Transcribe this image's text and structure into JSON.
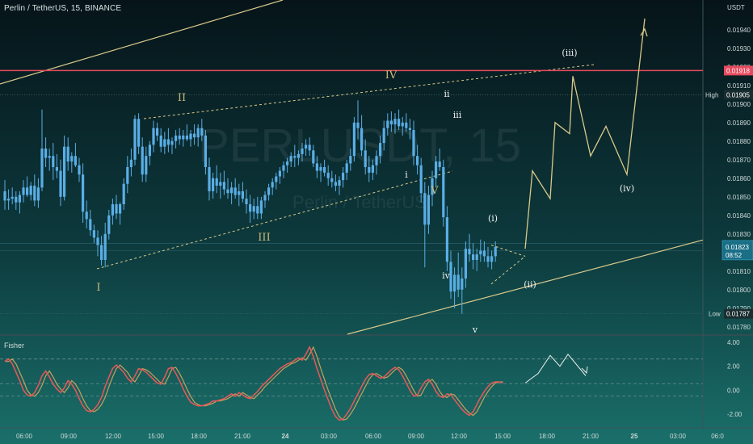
{
  "header": {
    "symbol_line": "Perlin / TetherUS, 15, BINANCE"
  },
  "watermark": {
    "ticker": "PERLUSDT, 15",
    "name": "Perlin / TetherUS"
  },
  "colors": {
    "bg_top": "#061419",
    "bg_bottom": "#1a6f6a",
    "candle": "#5aaee6",
    "wave_line": "#d9c98a",
    "resistance": "#e64a5e",
    "fisher": "#e0585c",
    "axis_text": "#cfdada"
  },
  "price_axis": {
    "currency": "USDT",
    "ticks": [
      "0.01940",
      "0.01930",
      "0.01920",
      "0.01910",
      "0.01900",
      "0.01890",
      "0.01880",
      "0.01870",
      "0.01860",
      "0.01850",
      "0.01840",
      "0.01830",
      "0.01820",
      "0.01810",
      "0.01800",
      "0.01790",
      "0.01780"
    ],
    "resistance_label": "0.01918",
    "high": {
      "label": "High",
      "value": "0.01905"
    },
    "last": {
      "value": "0.01823",
      "countdown": "08:52"
    },
    "low": {
      "label": "Low",
      "value": "0.01787"
    }
  },
  "time_axis": {
    "labels": [
      "06:00",
      "09:00",
      "12:00",
      "15:00",
      "18:00",
      "21:00",
      "24",
      "03:00",
      "06:00",
      "09:00",
      "12:00",
      "15:00",
      "18:00",
      "21:00",
      "25",
      "03:00",
      "06:0"
    ]
  },
  "fisher": {
    "title": "Fisher",
    "ticks": [
      "4.00",
      "2.00",
      "0.00",
      "-2.00"
    ]
  },
  "wave_labels": {
    "major": [
      "I",
      "II",
      "III",
      "IV",
      "V"
    ],
    "minor": [
      "i",
      "ii",
      "iii",
      "iv",
      "v"
    ],
    "projected": [
      "(i)",
      "(ii)",
      "(iii)",
      "(iv)"
    ]
  },
  "chart_data": {
    "type": "candlestick",
    "timeframe": "15",
    "exchange": "BINANCE",
    "y_range": [
      0.01776,
      0.01956
    ],
    "resistance": 0.01918,
    "high": 0.01905,
    "low": 0.01787,
    "last": 0.01823,
    "candles": [
      [
        0.01853,
        0.01859,
        0.01843,
        0.01848
      ],
      [
        0.01848,
        0.01854,
        0.01843,
        0.01849
      ],
      [
        0.01849,
        0.01855,
        0.01846,
        0.0185
      ],
      [
        0.0185,
        0.01853,
        0.01843,
        0.01847
      ],
      [
        0.01847,
        0.01853,
        0.01841,
        0.01851
      ],
      [
        0.01851,
        0.01859,
        0.01847,
        0.01855
      ],
      [
        0.01855,
        0.01861,
        0.0185,
        0.01851
      ],
      [
        0.01851,
        0.01858,
        0.01848,
        0.01856
      ],
      [
        0.01856,
        0.01862,
        0.01845,
        0.01848
      ],
      [
        0.01848,
        0.0186,
        0.01844,
        0.01855
      ],
      [
        0.01855,
        0.01897,
        0.01853,
        0.01876
      ],
      [
        0.01876,
        0.01882,
        0.01866,
        0.01871
      ],
      [
        0.01871,
        0.01876,
        0.01864,
        0.01872
      ],
      [
        0.01872,
        0.01879,
        0.01859,
        0.01866
      ],
      [
        0.01866,
        0.01873,
        0.0186,
        0.01864
      ],
      [
        0.01864,
        0.0187,
        0.01845,
        0.0185
      ],
      [
        0.0185,
        0.01883,
        0.01848,
        0.01877
      ],
      [
        0.01877,
        0.01882,
        0.01864,
        0.01869
      ],
      [
        0.01869,
        0.01874,
        0.01863,
        0.01872
      ],
      [
        0.01872,
        0.01879,
        0.01866,
        0.01867
      ],
      [
        0.01867,
        0.01871,
        0.01858,
        0.01862
      ],
      [
        0.01862,
        0.01868,
        0.01836,
        0.01842
      ],
      [
        0.01842,
        0.01848,
        0.01833,
        0.01838
      ],
      [
        0.01838,
        0.01843,
        0.01829,
        0.01832
      ],
      [
        0.01832,
        0.01835,
        0.01825,
        0.01828
      ],
      [
        0.01828,
        0.01832,
        0.01818,
        0.01824
      ],
      [
        0.01824,
        0.01829,
        0.01813,
        0.01816
      ],
      [
        0.01816,
        0.01836,
        0.01812,
        0.0183
      ],
      [
        0.0183,
        0.01843,
        0.01827,
        0.0184
      ],
      [
        0.0184,
        0.01849,
        0.01835,
        0.01846
      ],
      [
        0.01846,
        0.01851,
        0.01838,
        0.01841
      ],
      [
        0.01841,
        0.01847,
        0.01835,
        0.01846
      ],
      [
        0.01846,
        0.0186,
        0.01843,
        0.01857
      ],
      [
        0.01857,
        0.01872,
        0.01852,
        0.01866
      ],
      [
        0.01866,
        0.01876,
        0.01861,
        0.0187
      ],
      [
        0.0187,
        0.01894,
        0.01867,
        0.01892
      ],
      [
        0.01892,
        0.01895,
        0.01873,
        0.01877
      ],
      [
        0.01877,
        0.01882,
        0.01858,
        0.01862
      ],
      [
        0.01862,
        0.01877,
        0.01858,
        0.01872
      ],
      [
        0.01872,
        0.0188,
        0.01867,
        0.01878
      ],
      [
        0.01878,
        0.01891,
        0.01874,
        0.01887
      ],
      [
        0.01887,
        0.0189,
        0.0188,
        0.01883
      ],
      [
        0.01883,
        0.01887,
        0.01874,
        0.01877
      ],
      [
        0.01877,
        0.01885,
        0.01873,
        0.01881
      ],
      [
        0.01881,
        0.01887,
        0.01874,
        0.01878
      ],
      [
        0.01878,
        0.01882,
        0.01873,
        0.0188
      ],
      [
        0.0188,
        0.01886,
        0.01876,
        0.01883
      ],
      [
        0.01883,
        0.01887,
        0.01878,
        0.01881
      ],
      [
        0.01881,
        0.01886,
        0.01877,
        0.01883
      ],
      [
        0.01883,
        0.01889,
        0.0188,
        0.01881
      ],
      [
        0.01881,
        0.01886,
        0.01877,
        0.01884
      ],
      [
        0.01884,
        0.01889,
        0.01878,
        0.01882
      ],
      [
        0.01882,
        0.01889,
        0.01877,
        0.01887
      ],
      [
        0.01887,
        0.01892,
        0.0188,
        0.01883
      ],
      [
        0.01883,
        0.01886,
        0.01862,
        0.01866
      ],
      [
        0.01866,
        0.01871,
        0.01848,
        0.01853
      ],
      [
        0.01853,
        0.01863,
        0.01849,
        0.0186
      ],
      [
        0.0186,
        0.01867,
        0.01852,
        0.01856
      ],
      [
        0.01856,
        0.01863,
        0.01849,
        0.01858
      ],
      [
        0.01858,
        0.01864,
        0.01851,
        0.01854
      ],
      [
        0.01854,
        0.0186,
        0.01849,
        0.01852
      ],
      [
        0.01852,
        0.01858,
        0.01846,
        0.01855
      ],
      [
        0.01855,
        0.0186,
        0.01849,
        0.01851
      ],
      [
        0.01851,
        0.01857,
        0.01845,
        0.01853
      ],
      [
        0.01853,
        0.01858,
        0.01847,
        0.01849
      ],
      [
        0.01849,
        0.01854,
        0.01841,
        0.01846
      ],
      [
        0.01846,
        0.01851,
        0.01836,
        0.01842
      ],
      [
        0.01842,
        0.01849,
        0.01838,
        0.01845
      ],
      [
        0.01845,
        0.0185,
        0.01838,
        0.01841
      ],
      [
        0.01841,
        0.0185,
        0.01838,
        0.01848
      ],
      [
        0.01848,
        0.01853,
        0.01844,
        0.01851
      ],
      [
        0.01851,
        0.01857,
        0.01848,
        0.01855
      ],
      [
        0.01855,
        0.0186,
        0.01851,
        0.01858
      ],
      [
        0.01858,
        0.01863,
        0.01854,
        0.01861
      ],
      [
        0.01861,
        0.01866,
        0.01857,
        0.01864
      ],
      [
        0.01864,
        0.01869,
        0.0186,
        0.01867
      ],
      [
        0.01867,
        0.01871,
        0.01863,
        0.01869
      ],
      [
        0.01869,
        0.01874,
        0.01866,
        0.01872
      ],
      [
        0.01872,
        0.01878,
        0.01866,
        0.01871
      ],
      [
        0.01871,
        0.01875,
        0.01867,
        0.01873
      ],
      [
        0.01873,
        0.01879,
        0.01869,
        0.01876
      ],
      [
        0.01876,
        0.01881,
        0.01872,
        0.01878
      ],
      [
        0.01878,
        0.01882,
        0.01872,
        0.01875
      ],
      [
        0.01875,
        0.01878,
        0.01866,
        0.01868
      ],
      [
        0.01868,
        0.01872,
        0.0186,
        0.01864
      ],
      [
        0.01864,
        0.01868,
        0.01858,
        0.01866
      ],
      [
        0.01866,
        0.0187,
        0.01861,
        0.01863
      ],
      [
        0.01863,
        0.01867,
        0.01856,
        0.0186
      ],
      [
        0.0186,
        0.01864,
        0.01855,
        0.01858
      ],
      [
        0.01858,
        0.01862,
        0.01853,
        0.01856
      ],
      [
        0.01856,
        0.01861,
        0.01851,
        0.01859
      ],
      [
        0.01859,
        0.01866,
        0.01855,
        0.01863
      ],
      [
        0.01863,
        0.0187,
        0.01859,
        0.01868
      ],
      [
        0.01868,
        0.01876,
        0.01864,
        0.01872
      ],
      [
        0.01872,
        0.01893,
        0.01869,
        0.0189
      ],
      [
        0.0189,
        0.01902,
        0.01881,
        0.01887
      ],
      [
        0.01887,
        0.01894,
        0.01872,
        0.01875
      ],
      [
        0.01875,
        0.01881,
        0.01862,
        0.01866
      ],
      [
        0.01866,
        0.01872,
        0.01858,
        0.01863
      ],
      [
        0.01863,
        0.0187,
        0.01859,
        0.01867
      ],
      [
        0.01867,
        0.01875,
        0.01862,
        0.01872
      ],
      [
        0.01872,
        0.01883,
        0.01868,
        0.01879
      ],
      [
        0.01879,
        0.01891,
        0.01875,
        0.01887
      ],
      [
        0.01887,
        0.01895,
        0.01883,
        0.01891
      ],
      [
        0.01891,
        0.01896,
        0.01885,
        0.01889
      ],
      [
        0.01889,
        0.01895,
        0.01884,
        0.01892
      ],
      [
        0.01892,
        0.01897,
        0.01886,
        0.01888
      ],
      [
        0.01888,
        0.01893,
        0.01883,
        0.0189
      ],
      [
        0.0189,
        0.01895,
        0.01885,
        0.01887
      ],
      [
        0.01887,
        0.01892,
        0.01881,
        0.01886
      ],
      [
        0.01886,
        0.01891,
        0.01867,
        0.01872
      ],
      [
        0.01872,
        0.01878,
        0.01862,
        0.01867
      ],
      [
        0.01867,
        0.01871,
        0.01847,
        0.01852
      ],
      [
        0.01852,
        0.01858,
        0.01812,
        0.01835
      ],
      [
        0.01835,
        0.01856,
        0.0183,
        0.01851
      ],
      [
        0.01851,
        0.01864,
        0.01845,
        0.0186
      ],
      [
        0.0186,
        0.01872,
        0.01855,
        0.01869
      ],
      [
        0.01869,
        0.01876,
        0.01864,
        0.01866
      ],
      [
        0.01866,
        0.0187,
        0.01834,
        0.01839
      ],
      [
        0.01839,
        0.01845,
        0.0181,
        0.01815
      ],
      [
        0.01815,
        0.01821,
        0.01795,
        0.01799
      ],
      [
        0.01799,
        0.01812,
        0.0179,
        0.01808
      ],
      [
        0.01808,
        0.0182,
        0.01796,
        0.018
      ],
      [
        0.018,
        0.01812,
        0.01787,
        0.01806
      ],
      [
        0.01806,
        0.01826,
        0.01801,
        0.01822
      ],
      [
        0.01822,
        0.0183,
        0.01815,
        0.01819
      ],
      [
        0.01819,
        0.01825,
        0.01811,
        0.01816
      ],
      [
        0.01816,
        0.01822,
        0.0181,
        0.01819
      ],
      [
        0.01819,
        0.01827,
        0.01815,
        0.01821
      ],
      [
        0.01821,
        0.01826,
        0.01815,
        0.01818
      ],
      [
        0.01818,
        0.01823,
        0.01812,
        0.01815
      ],
      [
        0.01815,
        0.01821,
        0.01811,
        0.01818
      ],
      [
        0.01818,
        0.01826,
        0.01815,
        0.01823
      ]
    ],
    "candles_format": "[open, high, low, close]",
    "projection_path": [
      0.01822,
      0.01864,
      0.01849,
      0.0189,
      0.01884,
      0.01915,
      0.01872,
      0.01888,
      0.01862,
      0.01946
    ],
    "fisher_indicator": {
      "y_range": [
        -2.6,
        4.4
      ],
      "levels": [
        2.6,
        0.55,
        -0.5
      ],
      "fisher": [
        2.4,
        2.6,
        2.2,
        1.5,
        0.8,
        0.0,
        -0.4,
        -0.5,
        -0.2,
        0.4,
        1.2,
        1.6,
        1.1,
        0.5,
        0.1,
        -0.2,
        0.2,
        0.8,
        0.5,
        0.0,
        -0.7,
        -1.3,
        -1.7,
        -1.8,
        -1.6,
        -1.2,
        -0.6,
        0.3,
        1.1,
        1.8,
        2.1,
        1.8,
        1.5,
        1.0,
        0.7,
        1.2,
        1.8,
        1.7,
        1.5,
        1.2,
        0.9,
        0.6,
        0.5,
        1.1,
        1.8,
        1.9,
        1.4,
        0.8,
        0.1,
        -0.5,
        -1.0,
        -1.2,
        -1.3,
        -1.3,
        -1.2,
        -1.1,
        -0.9,
        -0.9,
        -0.8,
        -0.7,
        -0.5,
        -0.3,
        -0.5,
        -0.2,
        -0.4,
        -0.6,
        -0.7,
        -0.4,
        -0.1,
        0.3,
        0.6,
        0.9,
        1.2,
        1.5,
        1.8,
        2.0,
        2.2,
        2.3,
        2.5,
        2.7,
        2.5,
        3.0,
        3.6,
        2.8,
        1.8,
        0.9,
        0.0,
        -0.8,
        -1.6,
        -2.2,
        -2.5,
        -2.4,
        -2.0,
        -1.5,
        -0.9,
        -0.3,
        0.3,
        0.9,
        1.3,
        1.4,
        1.2,
        1.0,
        1.1,
        1.4,
        1.7,
        1.9,
        1.7,
        1.2,
        0.6,
        0.0,
        -0.5,
        -0.4,
        0.2,
        0.7,
        0.9,
        0.5,
        -0.1,
        -0.5,
        -0.6,
        -0.3,
        -0.4,
        -0.8,
        -1.2,
        -1.6,
        -1.9,
        -2.1,
        -1.8,
        -1.2,
        -0.6,
        -0.1,
        0.3,
        0.6,
        0.7,
        0.7,
        0.6
      ],
      "projection": [
        0.6,
        1.4,
        2.9,
        2.0,
        3.0,
        1.2
      ]
    }
  }
}
